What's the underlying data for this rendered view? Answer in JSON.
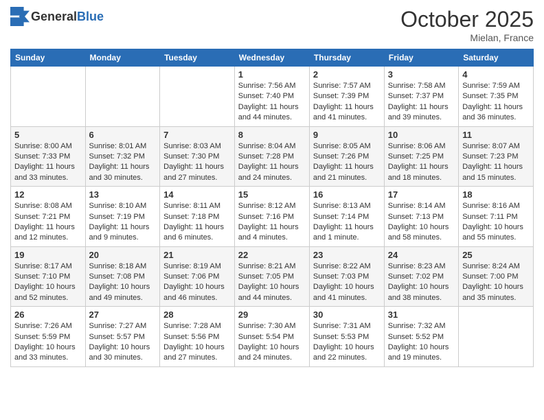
{
  "header": {
    "logo_general": "General",
    "logo_blue": "Blue",
    "month": "October 2025",
    "location": "Mielan, France"
  },
  "days_of_week": [
    "Sunday",
    "Monday",
    "Tuesday",
    "Wednesday",
    "Thursday",
    "Friday",
    "Saturday"
  ],
  "weeks": [
    [
      {
        "day": "",
        "info": ""
      },
      {
        "day": "",
        "info": ""
      },
      {
        "day": "",
        "info": ""
      },
      {
        "day": "1",
        "info": "Sunrise: 7:56 AM\nSunset: 7:40 PM\nDaylight: 11 hours and 44 minutes."
      },
      {
        "day": "2",
        "info": "Sunrise: 7:57 AM\nSunset: 7:39 PM\nDaylight: 11 hours and 41 minutes."
      },
      {
        "day": "3",
        "info": "Sunrise: 7:58 AM\nSunset: 7:37 PM\nDaylight: 11 hours and 39 minutes."
      },
      {
        "day": "4",
        "info": "Sunrise: 7:59 AM\nSunset: 7:35 PM\nDaylight: 11 hours and 36 minutes."
      }
    ],
    [
      {
        "day": "5",
        "info": "Sunrise: 8:00 AM\nSunset: 7:33 PM\nDaylight: 11 hours and 33 minutes."
      },
      {
        "day": "6",
        "info": "Sunrise: 8:01 AM\nSunset: 7:32 PM\nDaylight: 11 hours and 30 minutes."
      },
      {
        "day": "7",
        "info": "Sunrise: 8:03 AM\nSunset: 7:30 PM\nDaylight: 11 hours and 27 minutes."
      },
      {
        "day": "8",
        "info": "Sunrise: 8:04 AM\nSunset: 7:28 PM\nDaylight: 11 hours and 24 minutes."
      },
      {
        "day": "9",
        "info": "Sunrise: 8:05 AM\nSunset: 7:26 PM\nDaylight: 11 hours and 21 minutes."
      },
      {
        "day": "10",
        "info": "Sunrise: 8:06 AM\nSunset: 7:25 PM\nDaylight: 11 hours and 18 minutes."
      },
      {
        "day": "11",
        "info": "Sunrise: 8:07 AM\nSunset: 7:23 PM\nDaylight: 11 hours and 15 minutes."
      }
    ],
    [
      {
        "day": "12",
        "info": "Sunrise: 8:08 AM\nSunset: 7:21 PM\nDaylight: 11 hours and 12 minutes."
      },
      {
        "day": "13",
        "info": "Sunrise: 8:10 AM\nSunset: 7:19 PM\nDaylight: 11 hours and 9 minutes."
      },
      {
        "day": "14",
        "info": "Sunrise: 8:11 AM\nSunset: 7:18 PM\nDaylight: 11 hours and 6 minutes."
      },
      {
        "day": "15",
        "info": "Sunrise: 8:12 AM\nSunset: 7:16 PM\nDaylight: 11 hours and 4 minutes."
      },
      {
        "day": "16",
        "info": "Sunrise: 8:13 AM\nSunset: 7:14 PM\nDaylight: 11 hours and 1 minute."
      },
      {
        "day": "17",
        "info": "Sunrise: 8:14 AM\nSunset: 7:13 PM\nDaylight: 10 hours and 58 minutes."
      },
      {
        "day": "18",
        "info": "Sunrise: 8:16 AM\nSunset: 7:11 PM\nDaylight: 10 hours and 55 minutes."
      }
    ],
    [
      {
        "day": "19",
        "info": "Sunrise: 8:17 AM\nSunset: 7:10 PM\nDaylight: 10 hours and 52 minutes."
      },
      {
        "day": "20",
        "info": "Sunrise: 8:18 AM\nSunset: 7:08 PM\nDaylight: 10 hours and 49 minutes."
      },
      {
        "day": "21",
        "info": "Sunrise: 8:19 AM\nSunset: 7:06 PM\nDaylight: 10 hours and 46 minutes."
      },
      {
        "day": "22",
        "info": "Sunrise: 8:21 AM\nSunset: 7:05 PM\nDaylight: 10 hours and 44 minutes."
      },
      {
        "day": "23",
        "info": "Sunrise: 8:22 AM\nSunset: 7:03 PM\nDaylight: 10 hours and 41 minutes."
      },
      {
        "day": "24",
        "info": "Sunrise: 8:23 AM\nSunset: 7:02 PM\nDaylight: 10 hours and 38 minutes."
      },
      {
        "day": "25",
        "info": "Sunrise: 8:24 AM\nSunset: 7:00 PM\nDaylight: 10 hours and 35 minutes."
      }
    ],
    [
      {
        "day": "26",
        "info": "Sunrise: 7:26 AM\nSunset: 5:59 PM\nDaylight: 10 hours and 33 minutes."
      },
      {
        "day": "27",
        "info": "Sunrise: 7:27 AM\nSunset: 5:57 PM\nDaylight: 10 hours and 30 minutes."
      },
      {
        "day": "28",
        "info": "Sunrise: 7:28 AM\nSunset: 5:56 PM\nDaylight: 10 hours and 27 minutes."
      },
      {
        "day": "29",
        "info": "Sunrise: 7:30 AM\nSunset: 5:54 PM\nDaylight: 10 hours and 24 minutes."
      },
      {
        "day": "30",
        "info": "Sunrise: 7:31 AM\nSunset: 5:53 PM\nDaylight: 10 hours and 22 minutes."
      },
      {
        "day": "31",
        "info": "Sunrise: 7:32 AM\nSunset: 5:52 PM\nDaylight: 10 hours and 19 minutes."
      },
      {
        "day": "",
        "info": ""
      }
    ]
  ]
}
